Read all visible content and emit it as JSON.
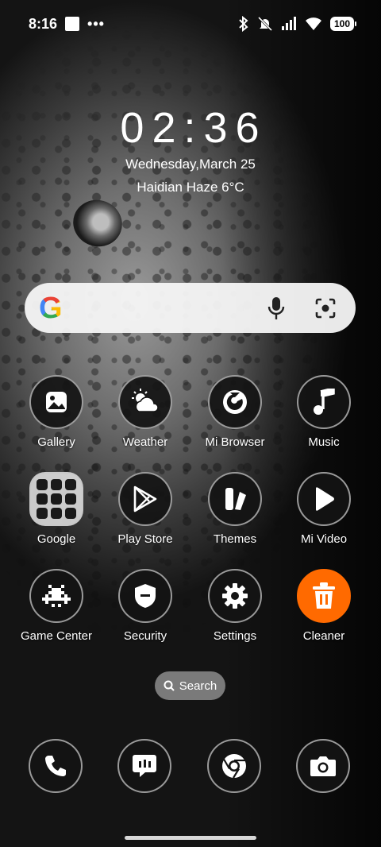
{
  "status_bar": {
    "time": "8:16",
    "dots": "•••",
    "battery": "100"
  },
  "clock": {
    "time": "02:36",
    "date": "Wednesday,March 25",
    "weather": "Haidian Haze 6°C"
  },
  "search_widget": {
    "logo": "G",
    "mic_icon": "mic-icon",
    "lens_icon": "camera-lens-icon"
  },
  "apps": [
    {
      "label": "Gallery",
      "icon": "gallery-icon"
    },
    {
      "label": "Weather",
      "icon": "weather-icon"
    },
    {
      "label": "Mi Browser",
      "icon": "browser-icon"
    },
    {
      "label": "Music",
      "icon": "music-icon"
    },
    {
      "label": "Google",
      "icon": "folder-icon"
    },
    {
      "label": "Play Store",
      "icon": "play-store-icon"
    },
    {
      "label": "Themes",
      "icon": "themes-icon"
    },
    {
      "label": "Mi Video",
      "icon": "video-play-icon"
    },
    {
      "label": "Game Center",
      "icon": "game-icon"
    },
    {
      "label": "Security",
      "icon": "shield-icon"
    },
    {
      "label": "Settings",
      "icon": "gear-icon"
    },
    {
      "label": "Cleaner",
      "icon": "trash-icon"
    }
  ],
  "search_pill": {
    "label": "Search"
  },
  "dock": [
    {
      "icon": "phone-icon"
    },
    {
      "icon": "message-icon"
    },
    {
      "icon": "chrome-icon"
    },
    {
      "icon": "camera-icon"
    }
  ],
  "colors": {
    "cleaner": "#ff6a00",
    "icon_bg": "#141414"
  }
}
